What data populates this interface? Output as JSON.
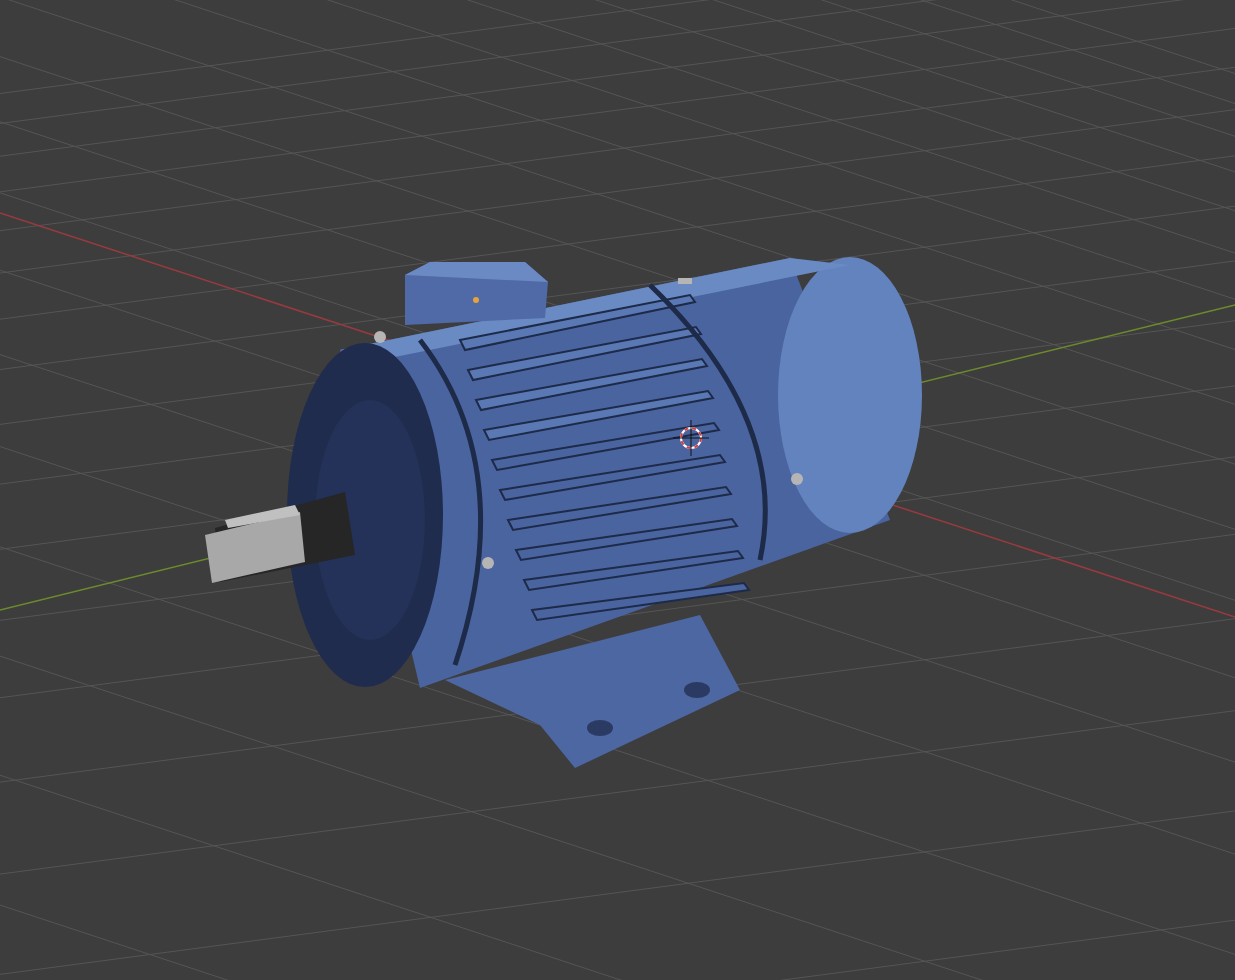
{
  "viewport": {
    "show_grid": true,
    "show_axes": true,
    "show_3d_cursor": true
  }
}
